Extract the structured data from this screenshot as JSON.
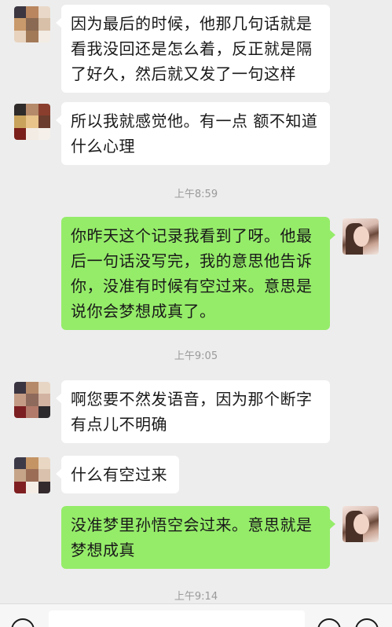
{
  "messages": [
    {
      "side": "left",
      "text": "因为最后的时候，他那几句话就是看我没回还是怎么着，反正就是隔了好久，然后就又发了一句这样"
    },
    {
      "side": "left",
      "text": "所以我就感觉他。有一点 额不知道什么心理"
    },
    {
      "side": "right",
      "text": "你昨天这个记录我看到了呀。他最后一句话没写完，我的意思他告诉你，没准有时候有空过来。意思是说你会梦想成真了。"
    },
    {
      "side": "left",
      "text": "啊您要不然发语音，因为那个断字有点儿不明确"
    },
    {
      "side": "left",
      "text": "什么有空过来"
    },
    {
      "side": "right",
      "text": "没准梦里孙悟空会过来。意思就是梦想成真"
    }
  ],
  "timestamps": [
    "上午8:59",
    "上午9:05",
    "上午9:14"
  ],
  "colors": {
    "background": "#ededed",
    "bubble_self": "#95ec69",
    "bubble_other": "#ffffff",
    "timestamp": "#9a9a9a"
  },
  "icons": {
    "voice_toggle": "voice-icon",
    "emoji": "emoji-icon",
    "more": "plus-icon"
  }
}
